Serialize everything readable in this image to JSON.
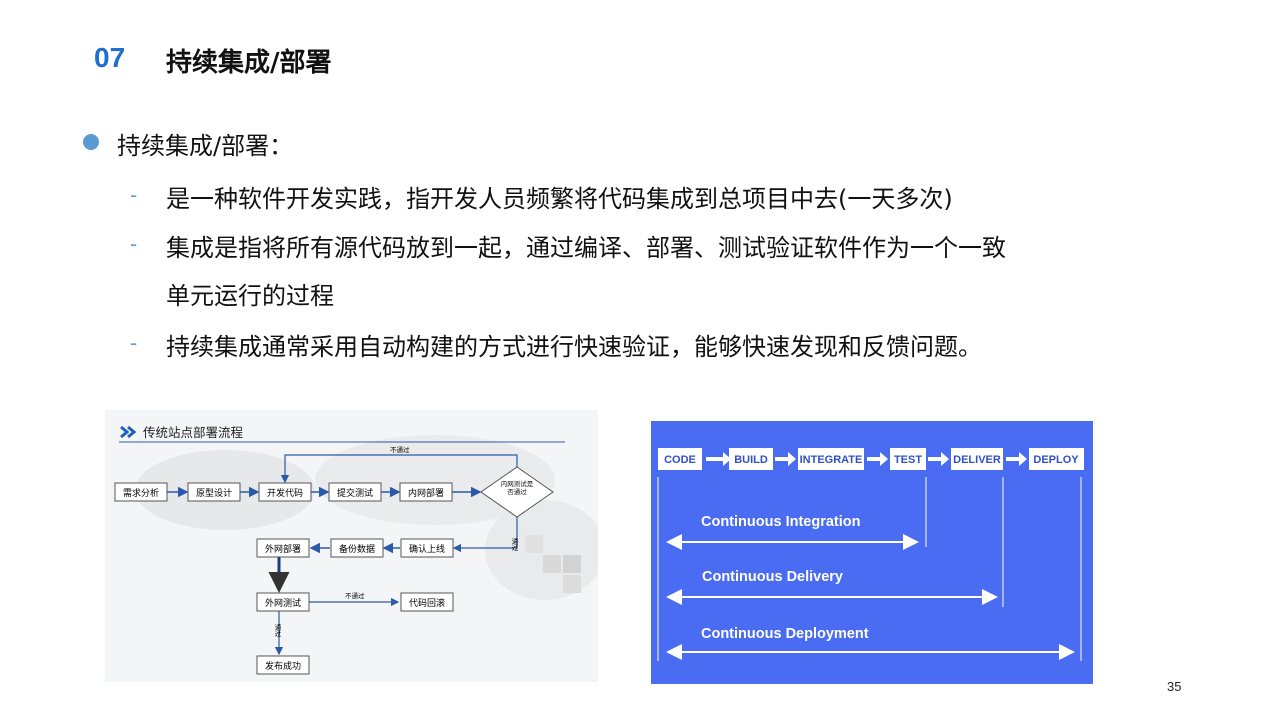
{
  "header": {
    "number": "07",
    "title": "持续集成/部署"
  },
  "bullet": {
    "label": "持续集成/部署："
  },
  "sub_items": [
    {
      "text": "是一种软件开发实践，指开发人员频繁将代码集成到总项目中去(一天多次)"
    },
    {
      "text": "集成是指将所有源代码放到一起，通过编译、部署、测试验证软件作为一个一致"
    },
    {
      "text": "单元运行的过程"
    },
    {
      "text": "持续集成通常采用自动构建的方式进行快速验证，能够快速发现和反馈问题。"
    }
  ],
  "flowchart": {
    "title": "传统站点部署流程",
    "steps": {
      "req": "需求分析",
      "proto": "原型设计",
      "dev": "开发代码",
      "submit": "提交测试",
      "intranet_deploy": "内网部署",
      "decision": "内网测试是否通过",
      "confirm": "确认上线",
      "backup": "备份数据",
      "ext_deploy": "外网部署",
      "ext_test": "外网测试",
      "rollback": "代码回滚",
      "publish": "发布成功"
    },
    "labels": {
      "fail_top": "不通过",
      "pass_right": "通过",
      "fail_mid": "不通过",
      "pass_down": "通过"
    }
  },
  "cicd": {
    "stages": [
      "CODE",
      "BUILD",
      "INTEGRATE",
      "TEST",
      "DELIVER",
      "DEPLOY"
    ],
    "spans": [
      "Continuous Integration",
      "Continuous Delivery",
      "Continuous Deployment"
    ],
    "colors": {
      "background": "#4a6cf2",
      "box": "#ffffff",
      "text": "#ffffff"
    }
  },
  "footer": {
    "page": "35"
  }
}
